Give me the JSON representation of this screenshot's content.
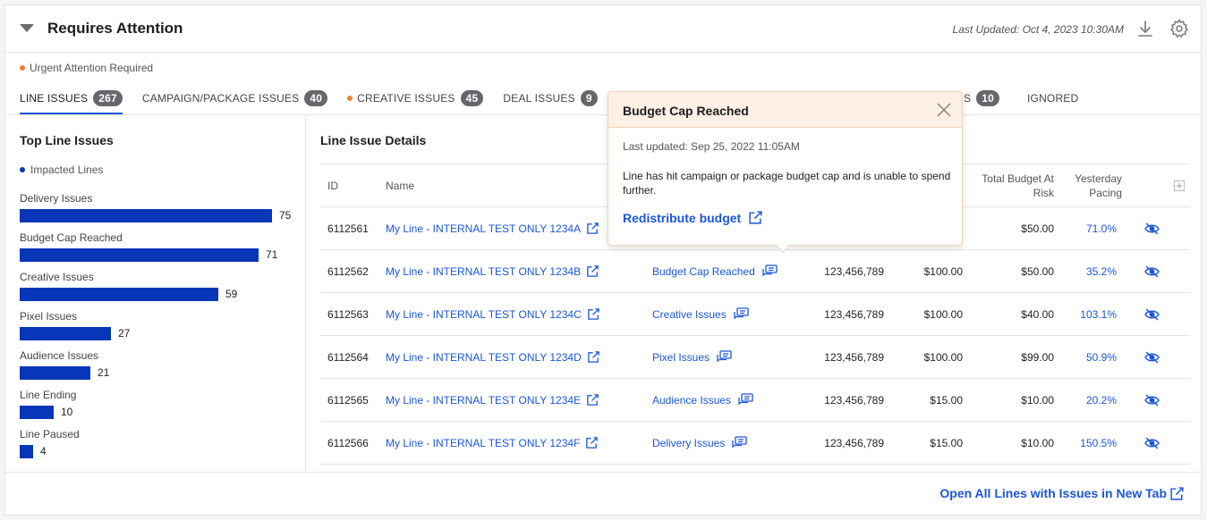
{
  "header": {
    "title": "Requires Attention",
    "last_updated": "Last Updated: Oct 4, 2023 10:30AM"
  },
  "urgent_legend": "Urgent Attention Required",
  "tabs": [
    {
      "label": "LINE ISSUES",
      "count": "267",
      "urgent": false,
      "active": true
    },
    {
      "label": "CAMPAIGN/PACKAGE ISSUES",
      "count": "40",
      "urgent": false
    },
    {
      "label": "CREATIVE ISSUES",
      "count": "45",
      "urgent": true
    },
    {
      "label": "DEAL ISSUES",
      "count": "9",
      "urgent": false
    },
    {
      "label": "S",
      "count": "10",
      "urgent": false
    },
    {
      "label": "IGNORED",
      "count": "",
      "urgent": false
    }
  ],
  "left_panel": {
    "title": "Top Line Issues",
    "legend": "Impacted Lines"
  },
  "chart_data": {
    "type": "bar",
    "categories": [
      "Delivery Issues",
      "Budget Cap Reached",
      "Creative Issues",
      "Pixel Issues",
      "Audience Issues",
      "Line Ending",
      "Line Paused"
    ],
    "values": [
      75,
      71,
      59,
      27,
      21,
      10,
      4
    ],
    "legend": [
      "Impacted Lines"
    ],
    "color": "#0836b8"
  },
  "right_panel": {
    "title": "Line Issue Details",
    "columns": [
      "ID",
      "Name",
      "Total Budget At Risk",
      "Yesterday Pacing"
    ],
    "rows": [
      {
        "id": "6112561",
        "name": "My Line - INTERNAL TEST ONLY 1234A",
        "issue": "",
        "impressions": "",
        "budget": "",
        "risk": "$50.00",
        "pacing": "71.0%"
      },
      {
        "id": "6112562",
        "name": "My Line - INTERNAL TEST ONLY 1234B",
        "issue": "Budget Cap Reached",
        "impressions": "123,456,789",
        "budget": "$100.00",
        "risk": "$50.00",
        "pacing": "35.2%"
      },
      {
        "id": "6112563",
        "name": "My Line - INTERNAL TEST ONLY 1234C",
        "issue": "Creative Issues",
        "impressions": "123,456,789",
        "budget": "$100.00",
        "risk": "$40.00",
        "pacing": "103.1%"
      },
      {
        "id": "6112564",
        "name": "My Line - INTERNAL TEST ONLY 1234D",
        "issue": "Pixel Issues",
        "impressions": "123,456,789",
        "budget": "$100.00",
        "risk": "$99.00",
        "pacing": "50.9%"
      },
      {
        "id": "6112565",
        "name": "My Line - INTERNAL TEST ONLY 1234E",
        "issue": "Audience Issues",
        "impressions": "123,456,789",
        "budget": "$15.00",
        "risk": "$10.00",
        "pacing": "20.2%"
      },
      {
        "id": "6112566",
        "name": "My Line - INTERNAL TEST ONLY 1234F",
        "issue": "Delivery Issues",
        "impressions": "123,456,789",
        "budget": "$15.00",
        "risk": "$10.00",
        "pacing": "150.5%"
      }
    ]
  },
  "popover": {
    "title": "Budget Cap Reached",
    "updated": "Last updated: Sep 25, 2022 11:05AM",
    "body": "Line has hit campaign or package budget cap and is unable to spend further.",
    "action": "Redistribute budget"
  },
  "footer": {
    "link": "Open All Lines with Issues in New Tab"
  },
  "colors": {
    "accent": "#1b56d8",
    "bar": "#0836b8",
    "urgent": "#f07e3a",
    "badge": "#66666b"
  }
}
